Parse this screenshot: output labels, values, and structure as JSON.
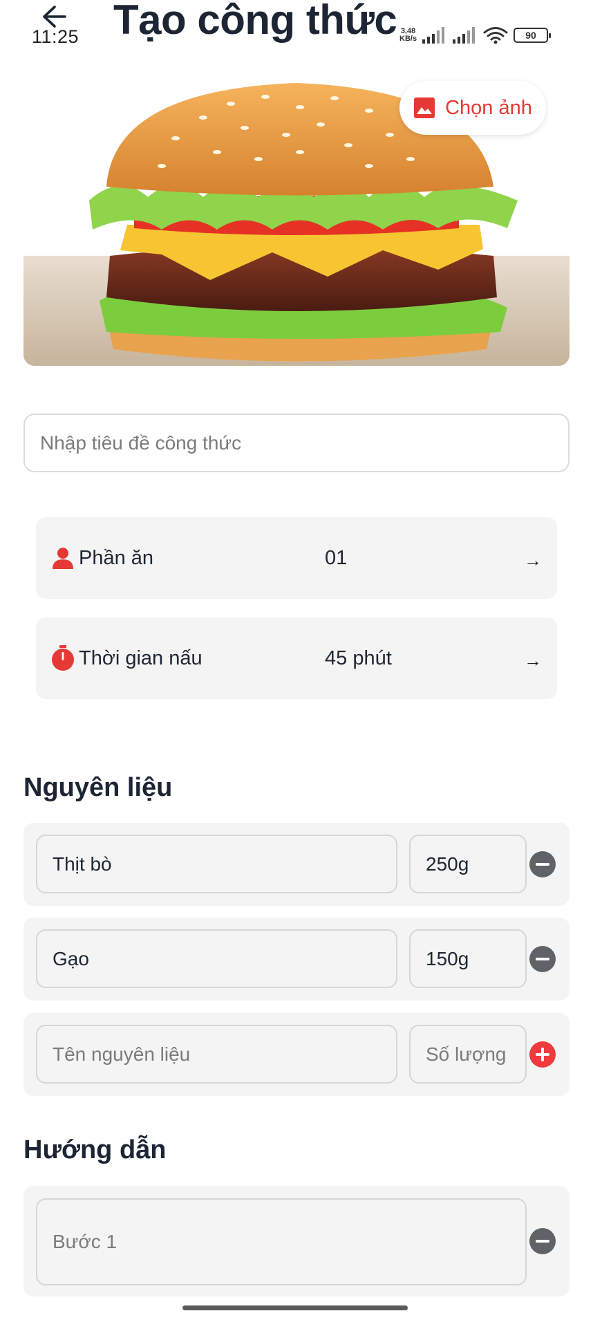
{
  "status_bar": {
    "time": "11:25",
    "net_speed_value": "3,48",
    "net_speed_unit": "KB/s",
    "battery": "90"
  },
  "header": {
    "title": "Tạo công thức"
  },
  "hero": {
    "choose_photo_label": "Chọn ảnh"
  },
  "recipe_title": {
    "value": "",
    "placeholder": "Nhập tiêu đề công thức"
  },
  "info": {
    "servings": {
      "label": "Phần ăn",
      "value": "01",
      "arrow": "→"
    },
    "cook_time": {
      "label": "Thời gian nấu",
      "value": "45 phút",
      "arrow": "→"
    }
  },
  "ingredients": {
    "heading": "Nguyên liệu",
    "items": [
      {
        "name": "Thịt bò",
        "quantity": "250g"
      },
      {
        "name": "Gạo",
        "quantity": "150g"
      }
    ],
    "new_item": {
      "name_placeholder": "Tên nguyên liệu",
      "quantity_placeholder": "Số lượng"
    }
  },
  "instructions": {
    "heading": "Hướng dẫn",
    "steps": [
      {
        "placeholder": "Bước 1",
        "value": ""
      }
    ]
  },
  "colors": {
    "accent": "#e53935",
    "remove_button": "#5f6368",
    "add_button": "#ef3b3b",
    "card_background": "#f4f4f4",
    "heading_text": "#1d2535"
  },
  "icons": {
    "back": "arrow-left-icon",
    "photo": "image-icon",
    "servings": "person-icon",
    "cook_time": "timer-icon",
    "remove": "minus-circle-icon",
    "add": "plus-circle-icon"
  }
}
